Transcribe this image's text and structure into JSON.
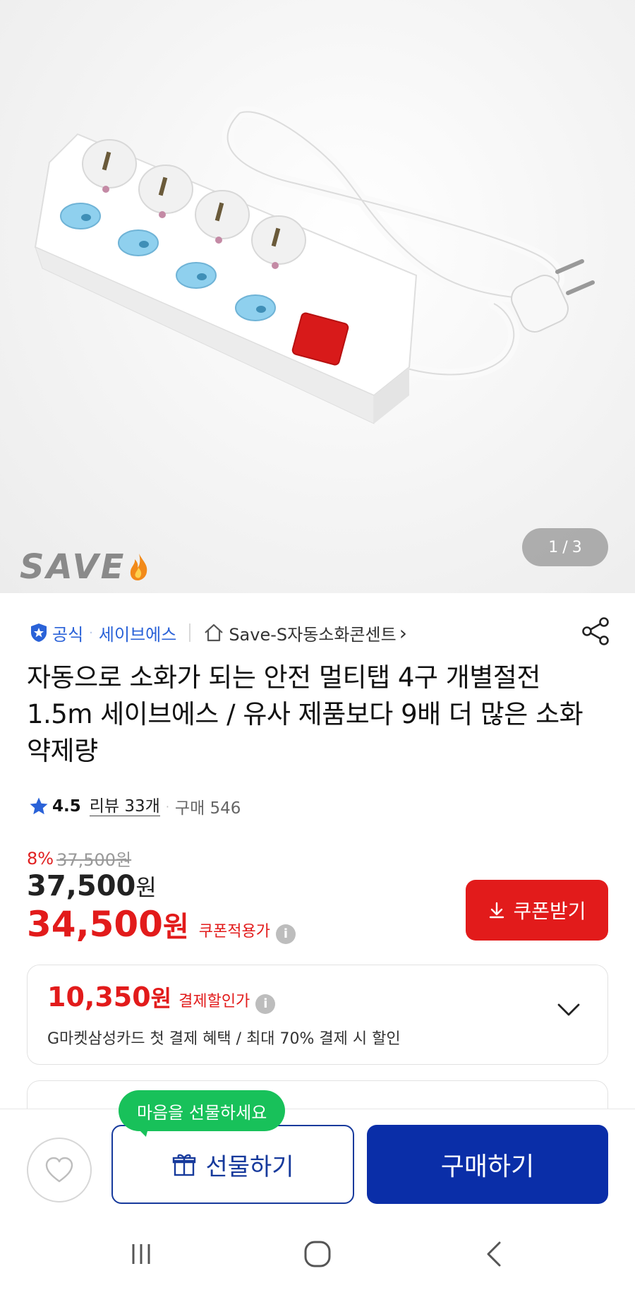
{
  "gallery": {
    "current": "1",
    "separator": "/",
    "total": "3",
    "brand_logo_text": "SAVE"
  },
  "seller": {
    "official_label": "공식",
    "dot": "·",
    "seller_name": "세이브에스",
    "store_name": "Save-S자동소화콘센트",
    "store_chevron": "›"
  },
  "product": {
    "title": "자동으로 소화가 되는 안전 멀티탭 4구 개별절전 1.5m 세이브에스 / 유사 제품보다 9배 더 많은 소화약제량"
  },
  "rating": {
    "score": "4.5",
    "review_label": "리뷰 33개",
    "purchase_label": "구매 546"
  },
  "pricing": {
    "discount_rate": "8%",
    "original_price": "37,500원",
    "price": "37,500",
    "price_unit": "원",
    "coupon_price": "34,500",
    "coupon_price_unit": "원",
    "coupon_tag": "쿠폰적용가",
    "coupon_button": "쿠폰받기"
  },
  "card_payment": {
    "amount": "10,350",
    "amount_unit": "원",
    "tag": "결제할인가",
    "description": "G마켓삼성카드 첫 결제 혜택 / 최대 70% 결제 시 할인"
  },
  "bottom_bar": {
    "tooltip": "마음을 선물하세요",
    "gift_button": "선물하기",
    "buy_button": "구매하기"
  },
  "colors": {
    "accent_red": "#e21b1b",
    "brand_blue": "#0a2ea8",
    "link_blue": "#2a62d8",
    "tooltip_green": "#18c15a"
  },
  "icons": {
    "official_badge": "shield-star-icon",
    "store": "home-icon",
    "share": "share-icon",
    "rating": "star-icon",
    "info": "info-icon",
    "coupon": "download-icon",
    "expand": "chevron-down-icon",
    "like": "heart-icon",
    "gift": "gift-icon",
    "nav_recent": "recent-apps-icon",
    "nav_home": "home-button-icon",
    "nav_back": "back-icon"
  }
}
